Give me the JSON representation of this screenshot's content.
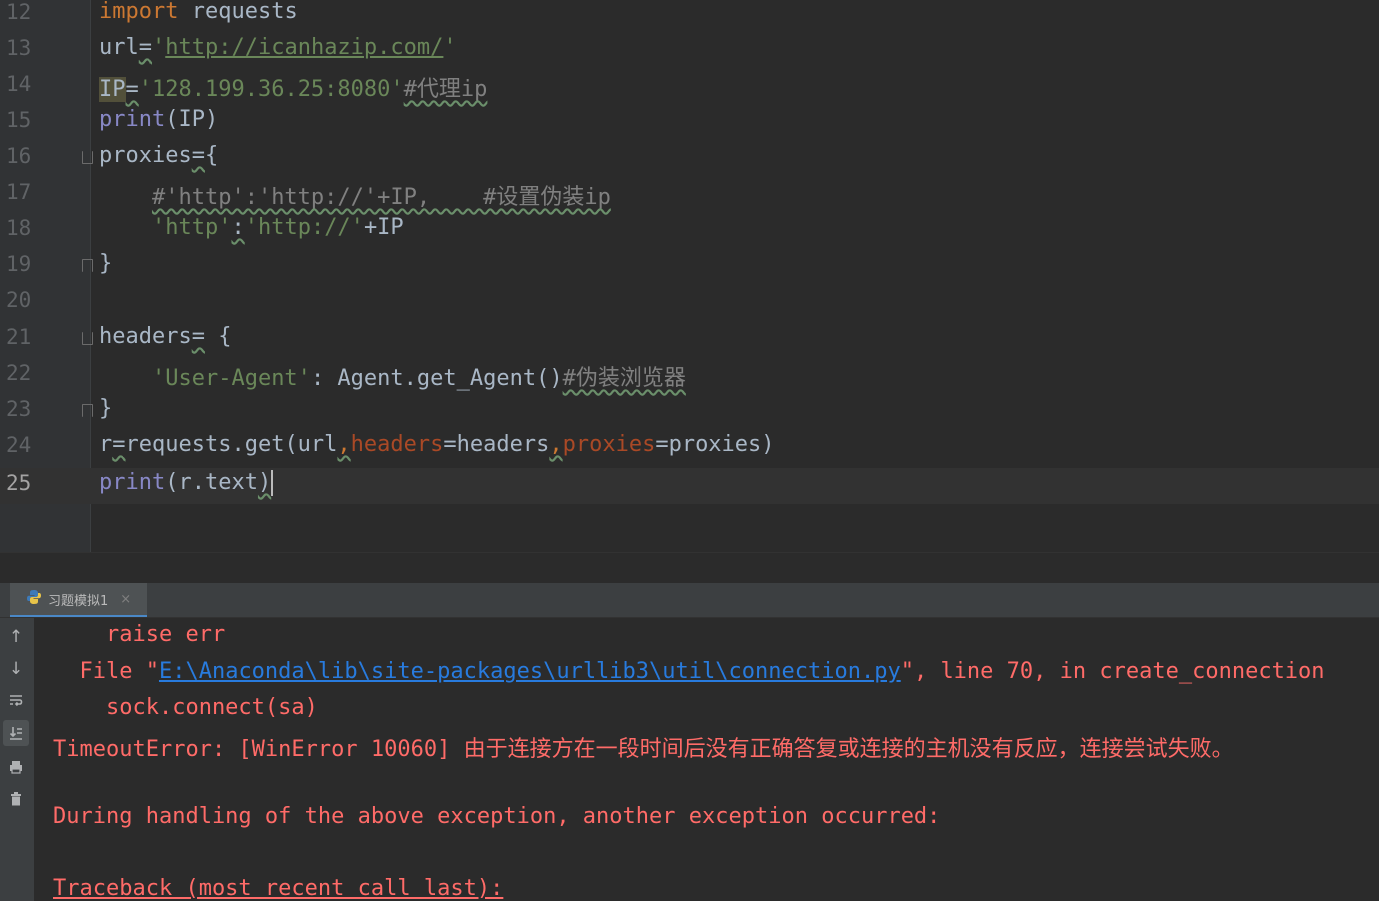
{
  "editor": {
    "lines": [
      {
        "num": "12"
      },
      {
        "num": "13"
      },
      {
        "num": "14"
      },
      {
        "num": "15"
      },
      {
        "num": "16"
      },
      {
        "num": "17"
      },
      {
        "num": "18"
      },
      {
        "num": "19"
      },
      {
        "num": "20"
      },
      {
        "num": "21"
      },
      {
        "num": "22"
      },
      {
        "num": "23"
      },
      {
        "num": "24"
      },
      {
        "num": "25"
      }
    ],
    "code": {
      "l12_kw": "import",
      "l12_rest": " requests",
      "l13_var": "url",
      "l13_eq": "=",
      "l13_q1": "'",
      "l13_url": "http://icanhazip.com/",
      "l13_q2": "'",
      "l14_var": "IP",
      "l14_eq": "=",
      "l14_str": "'128.199.36.25:8080'",
      "l14_comment": "#代理ip",
      "l15_fn": "print",
      "l15_rest": "(IP)",
      "l16_var": "proxies",
      "l16_eq": "=",
      "l16_brace": "{",
      "l17_indent": "    ",
      "l17_comment": "#'http':'http://'+IP,    #设置伪装ip",
      "l18_indent": "    ",
      "l18_s1": "'http'",
      "l18_colon": ":",
      "l18_s2": "'http://'",
      "l18_rest": "+IP",
      "l19_brace": "}",
      "l21_var": "headers",
      "l21_eq": "=",
      "l21_brace": " {",
      "l22_indent": "    ",
      "l22_str": "'User-Agent'",
      "l22_rest": ": Agent.get_Agent()",
      "l22_comment": "#伪装浏览器",
      "l23_brace": "}",
      "l24_a": "r",
      "l24_eq": "=",
      "l24_b": "requests.get(url",
      "l24_c1": ",",
      "l24_p1": "headers",
      "l24_d": "=headers",
      "l24_c2": ",",
      "l24_p2": "proxies",
      "l24_e": "=proxies)",
      "l25_fn": "print",
      "l25_rest": "(r.text",
      "l25_paren": ")"
    }
  },
  "run_panel": {
    "tab_label": "习题模拟1",
    "tab_close": "×",
    "toolbar_icons": [
      "up-arrow-icon",
      "down-arrow-icon",
      "soft-wrap-icon",
      "scroll-to-end-icon",
      "print-icon",
      "trash-icon"
    ],
    "console": {
      "l1": "    raise err",
      "l2_pre": "  File \"",
      "l2_link": "E:\\Anaconda\\lib\\site-packages\\urllib3\\util\\connection.py",
      "l2_post": "\", line 70, in create_connection",
      "l3": "    sock.connect(sa)",
      "l4": "TimeoutError: [WinError 10060] 由于连接方在一段时间后没有正确答复或连接的主机没有反应，连接尝试失败。",
      "l6": "During handling of the above exception, another exception occurred:",
      "l8": "Traceback (most recent call last):"
    }
  },
  "colors": {
    "background": "#2b2b2b",
    "keyword": "#cc7832",
    "string": "#6a8759",
    "builtin": "#8888c6",
    "comment": "#808080",
    "param": "#aa4926",
    "error": "#ff6b68",
    "link": "#287bde"
  }
}
